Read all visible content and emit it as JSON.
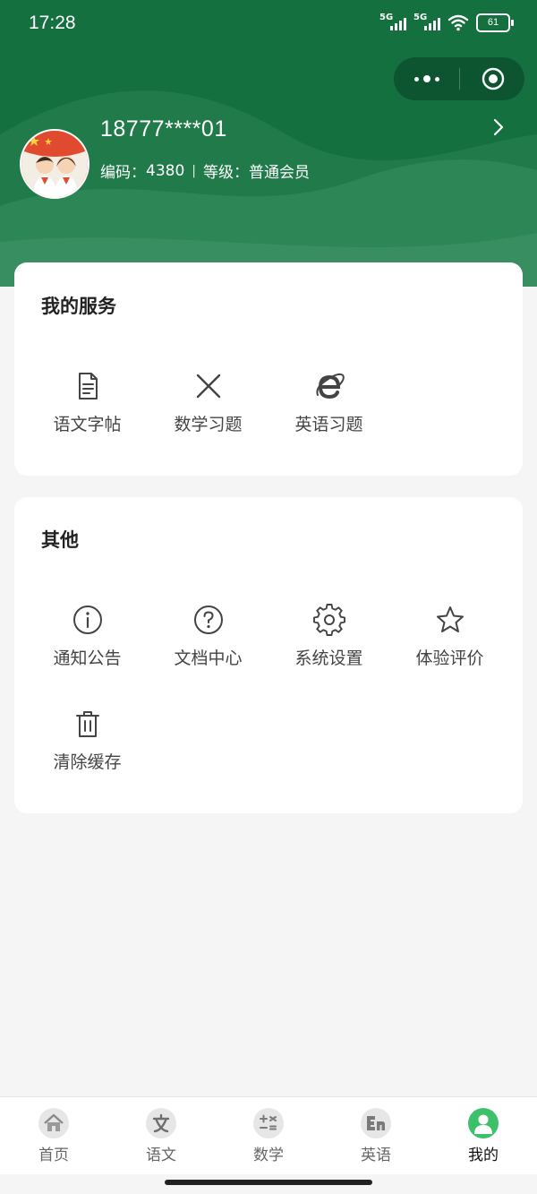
{
  "status_bar": {
    "time": "17:28",
    "net1": "5G",
    "net2": "5G",
    "battery": "61"
  },
  "user": {
    "name": "18777****01",
    "code_label": "编码：",
    "code": "4380",
    "divider": "|",
    "level_label": "等级：",
    "level": "普通会员"
  },
  "services": {
    "title": "我的服务",
    "items": [
      {
        "label": "语文字帖",
        "icon": "document-icon"
      },
      {
        "label": "数学习题",
        "icon": "close-x-icon"
      },
      {
        "label": "英语习题",
        "icon": "ie-browser-icon"
      }
    ]
  },
  "others": {
    "title": "其他",
    "items": [
      {
        "label": "通知公告",
        "icon": "info-icon"
      },
      {
        "label": "文档中心",
        "icon": "help-icon"
      },
      {
        "label": "系统设置",
        "icon": "gear-icon"
      },
      {
        "label": "体验评价",
        "icon": "star-icon"
      },
      {
        "label": "清除缓存",
        "icon": "trash-icon"
      }
    ]
  },
  "tabbar": {
    "items": [
      {
        "label": "首页",
        "icon": "home-icon"
      },
      {
        "label": "语文",
        "icon": "chinese-icon"
      },
      {
        "label": "数学",
        "icon": "math-icon"
      },
      {
        "label": "英语",
        "icon": "english-icon"
      },
      {
        "label": "我的",
        "icon": "user-icon",
        "active": true
      }
    ]
  },
  "colors": {
    "header_green": "#14703f",
    "capsule": "#0d5530",
    "active_tab": "#3cc06a",
    "background": "#f5f5f5"
  }
}
